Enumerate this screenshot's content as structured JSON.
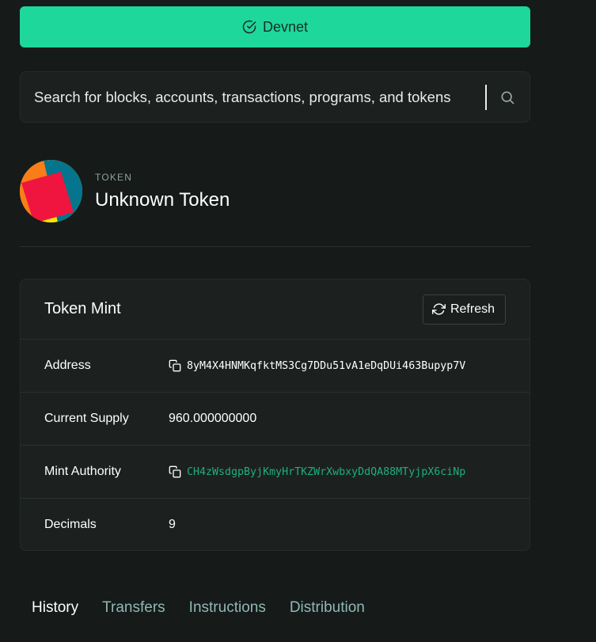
{
  "cluster": {
    "label": "Devnet",
    "icon": "check-circle-icon"
  },
  "search": {
    "placeholder": "Search for blocks, accounts, transactions, programs, and tokens",
    "icon": "search-icon"
  },
  "token": {
    "kicker": "TOKEN",
    "name": "Unknown Token"
  },
  "card": {
    "title": "Token Mint",
    "refresh_label": "Refresh",
    "rows": [
      {
        "label": "Address",
        "value": "8yM4X4HNMKqfktMS3Cg7DDu51vA1eDqDUi463Bupyp7V"
      },
      {
        "label": "Current Supply",
        "value": "960.000000000"
      },
      {
        "label": "Mint Authority",
        "value": "CH4zWsdgpByjKmyHrTKZWrXwbxyDdQA88MTyjpX6ciNp"
      },
      {
        "label": "Decimals",
        "value": "9"
      }
    ]
  },
  "tabs": [
    {
      "label": "History",
      "active": true
    },
    {
      "label": "Transfers",
      "active": false
    },
    {
      "label": "Instructions",
      "active": false
    },
    {
      "label": "Distribution",
      "active": false
    }
  ],
  "colors": {
    "background": "#161a19",
    "accent": "#1dd79b",
    "link": "#1fae7f",
    "card": "#1c2120"
  }
}
